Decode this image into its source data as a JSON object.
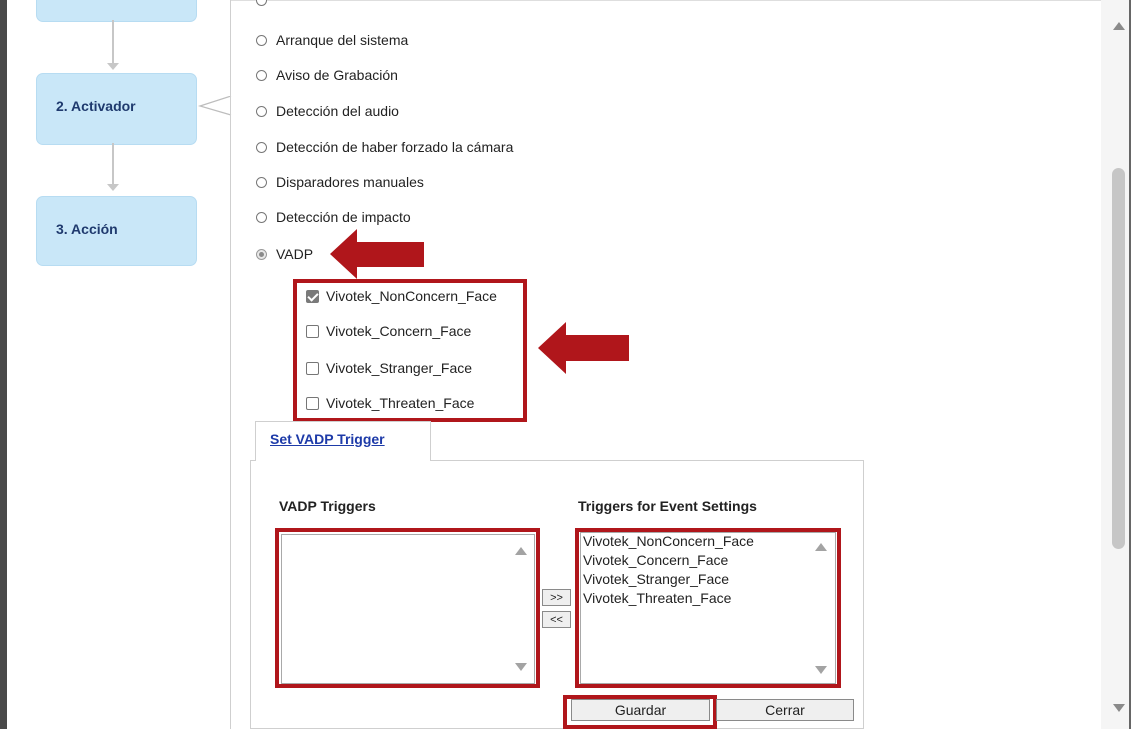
{
  "colors": {
    "step_bg": "#c9e7f8",
    "step_text": "#1f3a6e",
    "highlight_red": "#b0161b",
    "link_blue": "#1d3aa8"
  },
  "steps": [
    {
      "label": ""
    },
    {
      "label": "2. Activador"
    },
    {
      "label": "3. Acción"
    }
  ],
  "trigger_options": [
    {
      "label": "Arranque del sistema",
      "selected": false
    },
    {
      "label": "Aviso de Grabación",
      "selected": false
    },
    {
      "label": "Detección del audio",
      "selected": false
    },
    {
      "label": "Detección de haber forzado la cámara",
      "selected": false
    },
    {
      "label": "Disparadores manuales",
      "selected": false
    },
    {
      "label": "Detección de impacto",
      "selected": false
    },
    {
      "label": "VADP",
      "selected": true
    }
  ],
  "vadp_checkboxes": [
    {
      "label": "Vivotek_NonConcern_Face",
      "checked": true
    },
    {
      "label": "Vivotek_Concern_Face",
      "checked": false
    },
    {
      "label": "Vivotek_Stranger_Face",
      "checked": false
    },
    {
      "label": "Vivotek_Threaten_Face",
      "checked": false
    }
  ],
  "tab": {
    "label": "Set VADP Trigger"
  },
  "vadp_triggers": {
    "title": "VADP Triggers",
    "items": []
  },
  "event_triggers": {
    "title": "Triggers for Event Settings",
    "items": [
      "Vivotek_NonConcern_Face",
      "Vivotek_Concern_Face",
      "Vivotek_Stranger_Face",
      "Vivotek_Threaten_Face"
    ]
  },
  "move_buttons": {
    "add": ">>",
    "remove": "<<"
  },
  "actions": {
    "save": "Guardar",
    "close": "Cerrar"
  }
}
